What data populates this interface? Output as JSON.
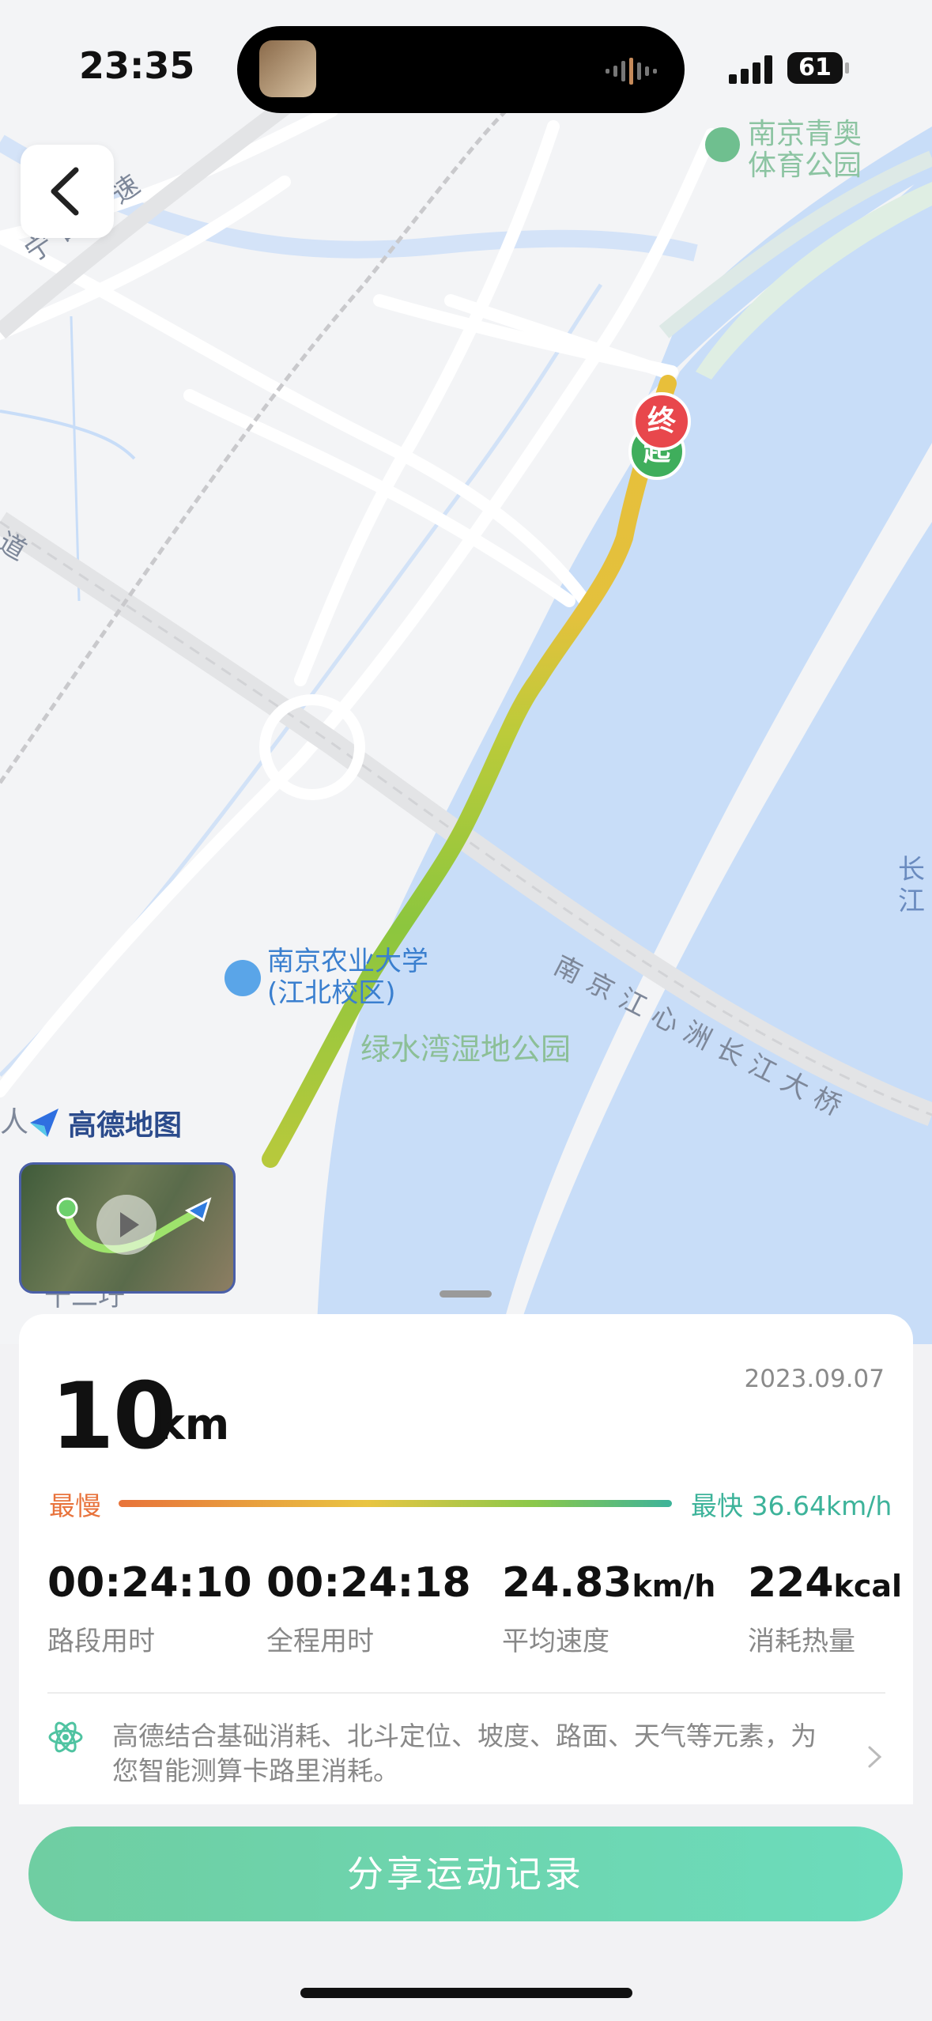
{
  "status_bar": {
    "time": "23:35",
    "battery": "61"
  },
  "map": {
    "labels": {
      "expressway": "宁合高速",
      "road_left": "道",
      "park_top": "南京青奥体育公园",
      "university": "南京农业大学(江北校区)",
      "university_line1": "南京农业大学",
      "university_line2": "(江北校区)",
      "wetland": "绿水湾湿地公园",
      "bridge": "南京江心洲长江大桥",
      "river": "长江",
      "left_edge": "人",
      "bottom_left": "十二圩"
    },
    "markers": {
      "end": "终",
      "start": "起"
    },
    "provider": "高德地图"
  },
  "summary": {
    "distance": "10",
    "distance_unit": "km",
    "date": "2023.09.07",
    "slowest_label": "最慢",
    "fastest_label": "最快",
    "fastest_value": "36.64km/h",
    "stats": [
      {
        "value": "00:24:10",
        "unit": "",
        "label": "路段用时"
      },
      {
        "value": "00:24:18",
        "unit": "",
        "label": "全程用时"
      },
      {
        "value": "24.83",
        "unit": "km/h",
        "label": "平均速度"
      },
      {
        "value": "224",
        "unit": "kcal",
        "label": "消耗热量"
      }
    ],
    "note": "高德结合基础消耗、北斗定位、坡度、路面、天气等元素，为您智能测算卡路里消耗。"
  },
  "share_button": "分享运动记录",
  "colors": {
    "accent": "#6fd0aa",
    "slow": "#e8733c",
    "fast": "#3db39a",
    "end_marker": "#e8474c",
    "start_marker": "#3fae5c"
  }
}
